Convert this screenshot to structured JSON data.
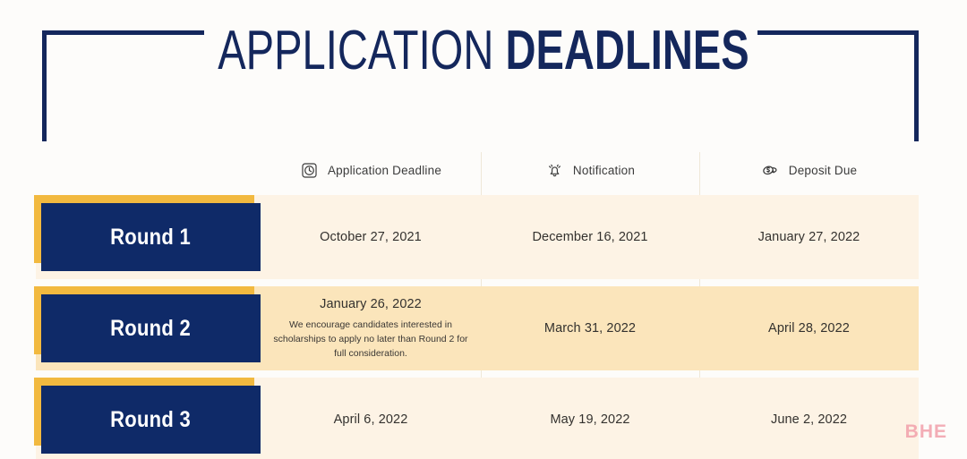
{
  "title": {
    "light": "APPLICATION ",
    "bold": "DEADLINES"
  },
  "columns": [
    {
      "label": "Application Deadline",
      "icon": "clock-icon"
    },
    {
      "label": "Notification",
      "icon": "bell-icon"
    },
    {
      "label": "Deposit Due",
      "icon": "money-icon"
    }
  ],
  "rows": [
    {
      "round": "Round 1",
      "deadline": "October 27, 2021",
      "deadline_note": "",
      "notification": "December 16, 2021",
      "deposit": "January 27, 2022"
    },
    {
      "round": "Round 2",
      "deadline": "January 26, 2022",
      "deadline_note": "We encourage candidates interested in scholarships to apply no later than Round 2 for full consideration.",
      "notification": "March 31, 2022",
      "deposit": "April 28, 2022"
    },
    {
      "round": "Round 3",
      "deadline": "April 6, 2022",
      "deadline_note": "",
      "notification": "May 19, 2022",
      "deposit": "June 2, 2022"
    }
  ],
  "watermark": "BHE",
  "colors": {
    "navy": "#0f2a68",
    "navy_dark": "#14275c",
    "gold": "#f2b93f",
    "row_light": "#fdf3e5",
    "row_highlight": "#fbe5bb",
    "page_bg": "#fdfcfa",
    "watermark": "#f2a0ab"
  }
}
